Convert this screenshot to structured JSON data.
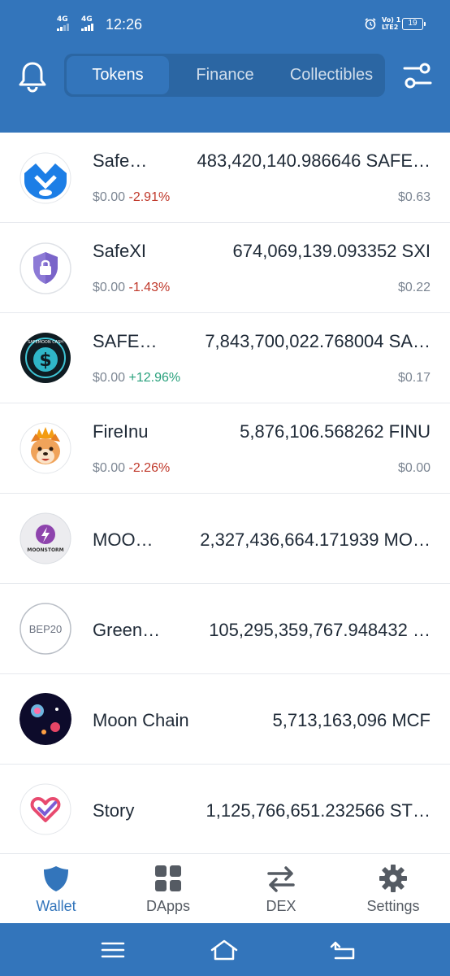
{
  "status_bar": {
    "time": "12:26",
    "sim1": "4G",
    "sim2": "4G",
    "volte_top": "Vo) 1",
    "volte_bottom": "LTE2",
    "battery": "19"
  },
  "header": {
    "tabs": [
      {
        "label": "Tokens",
        "active": true
      },
      {
        "label": "Finance",
        "active": false
      },
      {
        "label": "Collectibles",
        "active": false
      }
    ]
  },
  "tokens": [
    {
      "name": "Safe…",
      "balance": "483,420,140.986646 SAFE…",
      "price": "$0.00",
      "change": "-2.91%",
      "fiat": "$0.63"
    },
    {
      "name": "SafeXI",
      "balance": "674,069,139.093352 SXI",
      "price": "$0.00",
      "change": "-1.43%",
      "fiat": "$0.22"
    },
    {
      "name": "SAFE…",
      "balance": "7,843,700,022.768004 SA…",
      "price": "$0.00",
      "change": "+12.96%",
      "fiat": "$0.17"
    },
    {
      "name": "FireInu",
      "balance": "5,876,106.568262 FINU",
      "price": "$0.00",
      "change": "-2.26%",
      "fiat": "$0.00"
    },
    {
      "name": "MOO…",
      "balance": "2,327,436,664.171939 MO…",
      "logo_text": "MOONSTORM"
    },
    {
      "name": "Green…",
      "balance": "105,295,359,767.948432 …",
      "logo_text": "BEP20"
    },
    {
      "name": "Moon Chain",
      "balance": "5,713,163,096 MCF"
    },
    {
      "name": "Story",
      "balance": "1,125,766,651.232566 ST…"
    }
  ],
  "logo_texts": {
    "safemoon_cash": "SAFEMOON CASH"
  },
  "bottom_nav": [
    {
      "label": "Wallet",
      "icon": "shield-icon",
      "active": true
    },
    {
      "label": "DApps",
      "icon": "grid-icon",
      "active": false
    },
    {
      "label": "DEX",
      "icon": "swap-icon",
      "active": false
    },
    {
      "label": "Settings",
      "icon": "gear-icon",
      "active": false
    }
  ],
  "colors": {
    "brand": "#3375bb",
    "negative": "#c0392b",
    "positive": "#27a07b"
  }
}
